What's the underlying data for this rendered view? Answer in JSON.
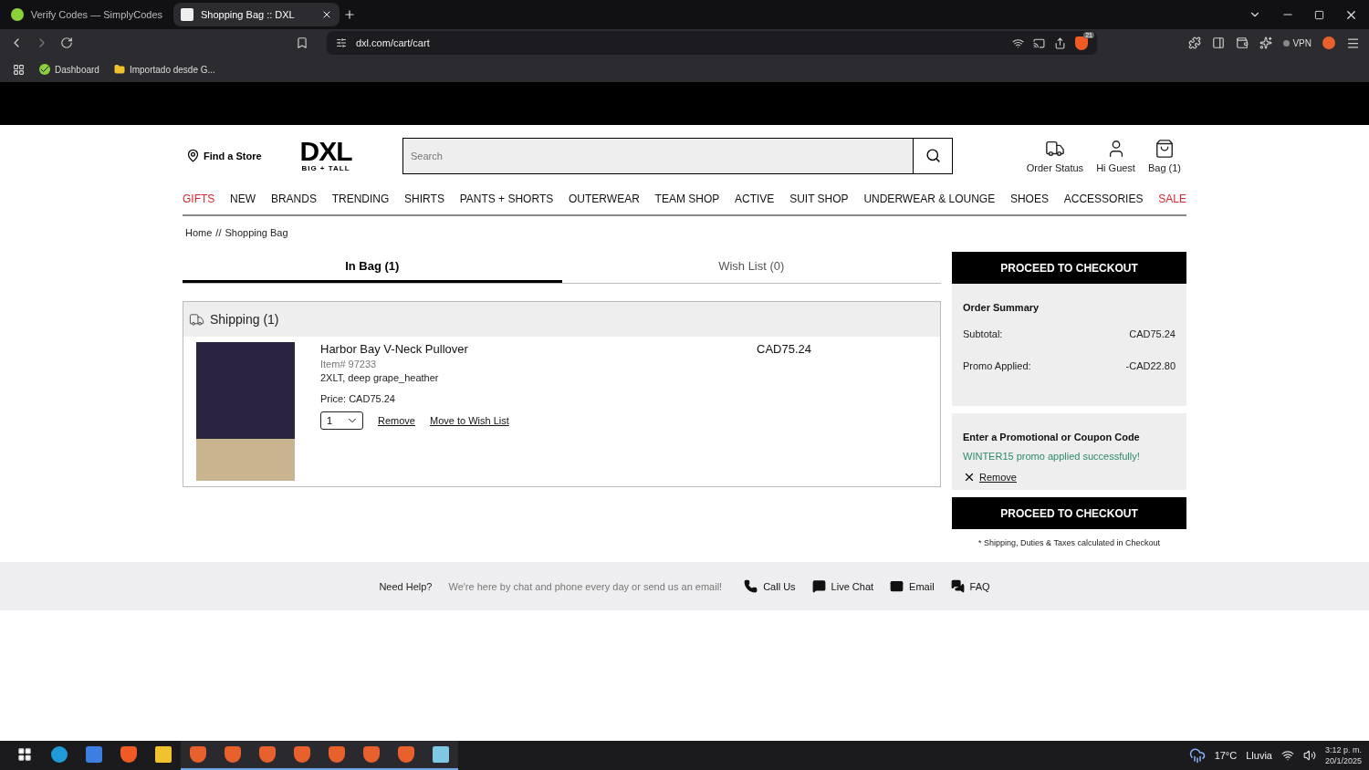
{
  "browser": {
    "tabs": [
      {
        "title": "Verify Codes — SimplyCodes",
        "selected": false
      },
      {
        "title": "Shopping Bag :: DXL",
        "selected": true
      }
    ],
    "url": "dxl.com/cart/cart",
    "shield_count": "21",
    "vpn": "VPN",
    "bookmarks": [
      {
        "label": "Dashboard",
        "kind": "site"
      },
      {
        "label": "Importado desde G...",
        "kind": "folder"
      }
    ]
  },
  "header": {
    "find_store": "Find a Store",
    "logo": {
      "main": "DXL",
      "sub": "BIG + TALL"
    },
    "search": {
      "placeholder": "Search"
    },
    "actions": [
      {
        "label": "Order Status",
        "kind": "truck"
      },
      {
        "label": "Hi Guest",
        "kind": "user"
      },
      {
        "label": "Bag (1)",
        "kind": "bag"
      }
    ]
  },
  "nav": [
    {
      "label": "GIFTS",
      "highlighted": true
    },
    {
      "label": "NEW",
      "highlighted": false
    },
    {
      "label": "BRANDS",
      "highlighted": false
    },
    {
      "label": "TRENDING",
      "highlighted": false
    },
    {
      "label": "SHIRTS",
      "highlighted": false
    },
    {
      "label": "PANTS + SHORTS",
      "highlighted": false
    },
    {
      "label": "OUTERWEAR",
      "highlighted": false
    },
    {
      "label": "TEAM SHOP",
      "highlighted": false
    },
    {
      "label": "ACTIVE",
      "highlighted": false
    },
    {
      "label": "SUIT SHOP",
      "highlighted": false
    },
    {
      "label": "UNDERWEAR & LOUNGE",
      "highlighted": false
    },
    {
      "label": "SHOES",
      "highlighted": false
    },
    {
      "label": "ACCESSORIES",
      "highlighted": false
    },
    {
      "label": "SALE",
      "highlighted": true
    }
  ],
  "breadcrumb": {
    "items": [
      "Home",
      "Shopping Bag"
    ],
    "separator": "//"
  },
  "bag_tabs": [
    {
      "label": "In Bag (1)",
      "selected": true
    },
    {
      "label": "Wish List (0)",
      "selected": false
    }
  ],
  "shipping": {
    "title": "Shipping (1)",
    "item": {
      "name": "Harbor Bay V-Neck Pullover",
      "item_no": "Item# 97233",
      "variant": "2XLT, deep grape_heather",
      "price": "Price: CAD75.24",
      "total": "CAD75.24",
      "quantity": "1",
      "actions": [
        "Remove",
        "Move to Wish List"
      ]
    }
  },
  "summary": {
    "checkout": "PROCEED TO CHECKOUT",
    "title": "Order Summary",
    "rows": [
      {
        "label": "Subtotal:",
        "value": "CAD75.24"
      },
      {
        "label": "Promo Applied:",
        "value": "-CAD22.80"
      }
    ],
    "promo": {
      "title": "Enter a Promotional or Coupon Code",
      "message": "WINTER15 promo applied successfully!",
      "remove": "Remove"
    },
    "checkout_bottom": "PROCEED TO CHECKOUT",
    "note": "* Shipping, Duties & Taxes calculated in Checkout"
  },
  "help": {
    "title": "Need Help?",
    "text": "We're here by chat and phone every day or send us an email!",
    "links": [
      {
        "label": "Call Us",
        "kind": "phone"
      },
      {
        "label": "Live Chat",
        "kind": "chat"
      },
      {
        "label": "Email",
        "kind": "mail"
      },
      {
        "label": "FAQ",
        "kind": "faq"
      }
    ]
  },
  "taskbar": {
    "apps": [
      {
        "kind": "edge",
        "open": false
      },
      {
        "kind": "store",
        "open": false
      },
      {
        "kind": "brave",
        "open": false
      },
      {
        "kind": "folder",
        "open": false
      },
      {
        "kind": "brave-profile",
        "open": true
      },
      {
        "kind": "brave-profile",
        "open": true
      },
      {
        "kind": "brave-profile",
        "open": true
      },
      {
        "kind": "brave-profile",
        "open": true
      },
      {
        "kind": "brave-profile",
        "open": true
      },
      {
        "kind": "brave-profile",
        "open": true
      },
      {
        "kind": "brave-profile",
        "open": true
      },
      {
        "kind": "notes",
        "open": true
      }
    ],
    "weather": {
      "temp": "17°C",
      "condition": "Lluvia"
    },
    "time": "3:12 p. m.",
    "date": "20/1/2025"
  }
}
